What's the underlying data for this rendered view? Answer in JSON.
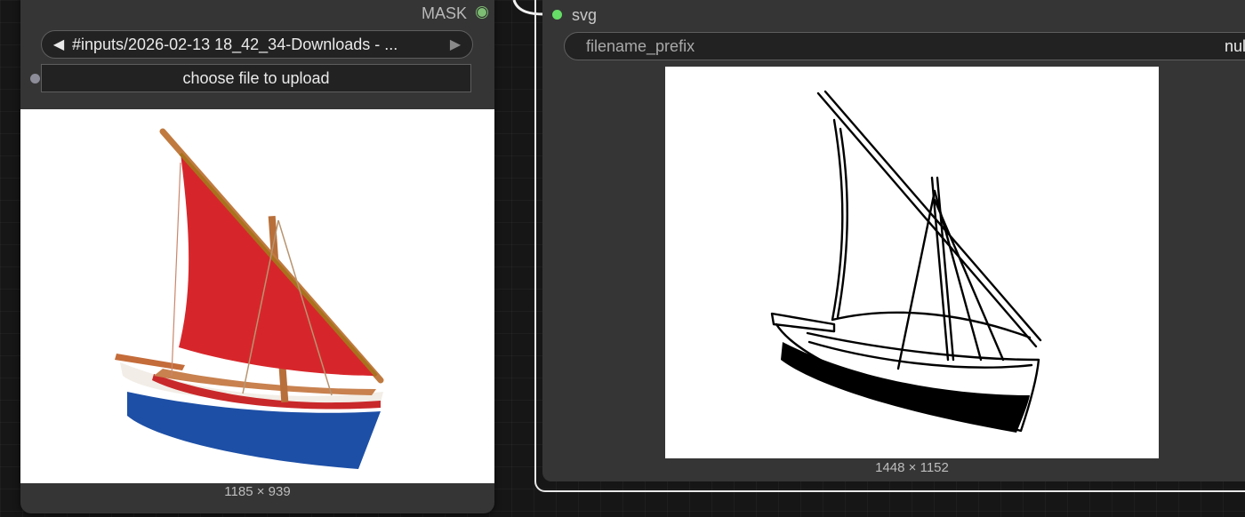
{
  "load_image_node": {
    "output_label": "MASK",
    "image_selector": {
      "prev_arrow": "◀",
      "value": "#inputs/2026-02-13 18_42_34-Downloads - ...",
      "next_arrow": "▶"
    },
    "upload_button_label": "choose file to upload",
    "preview_dimensions": "1185 × 939"
  },
  "save_svg_node": {
    "input_label": "svg",
    "filename_prefix_widget": {
      "name": "filename_prefix",
      "value": "null"
    },
    "preview_dimensions": "1448 × 1152"
  },
  "colors": {
    "canvas_background": "#161616",
    "node_background": "#353535",
    "widget_background": "#222222",
    "mask_output_dot": "#7ebd74",
    "svg_input_dot": "#66dd66",
    "sail_red": "#d7262b",
    "hull_blue": "#1d4fa6"
  },
  "icons": [
    "left-arrow-icon",
    "right-arrow-icon",
    "output-slot-icon",
    "input-slot-icon"
  ]
}
